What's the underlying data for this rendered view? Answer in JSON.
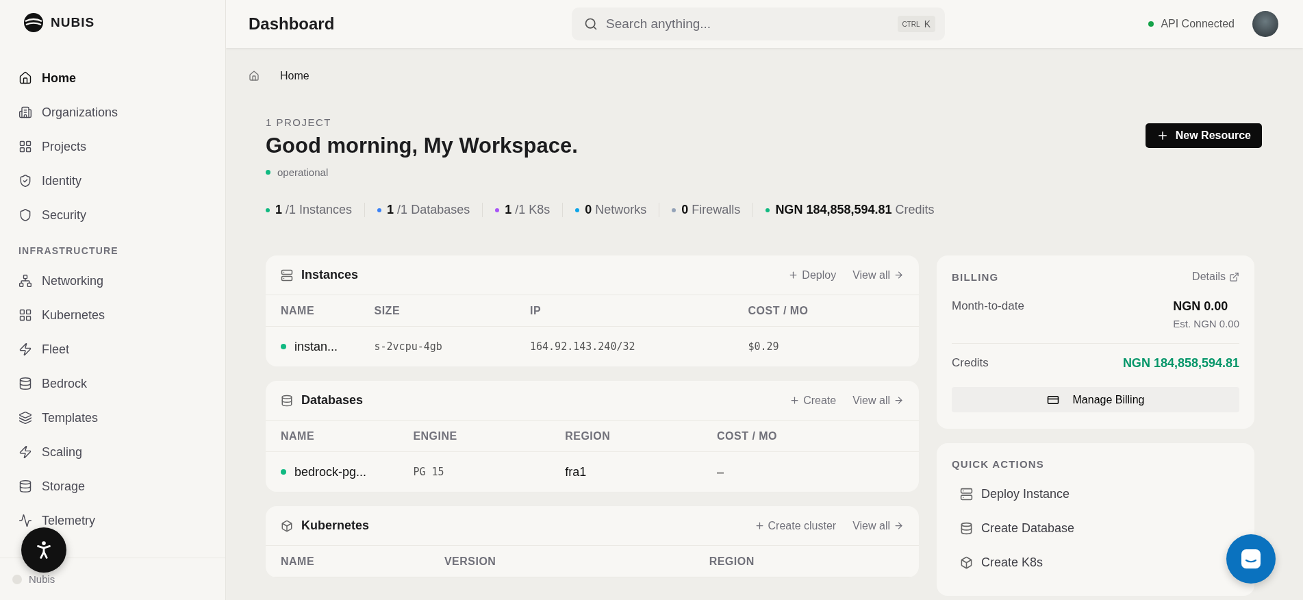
{
  "brand": {
    "name": "NUBIS"
  },
  "sidebar": {
    "items": [
      {
        "label": "Home",
        "selected": true
      },
      {
        "label": "Organizations",
        "selected": false
      },
      {
        "label": "Projects",
        "selected": false
      },
      {
        "label": "Identity",
        "selected": false
      },
      {
        "label": "Security",
        "selected": false
      }
    ],
    "section": "INFRASTRUCTURE",
    "infra_items": [
      {
        "label": "Networking",
        "selected": false
      },
      {
        "label": "Kubernetes",
        "selected": false
      },
      {
        "label": "Fleet",
        "selected": false
      },
      {
        "label": "Bedrock",
        "selected": false
      },
      {
        "label": "Templates",
        "selected": false
      },
      {
        "label": "Scaling",
        "selected": false
      },
      {
        "label": "Storage",
        "selected": false
      },
      {
        "label": "Telemetry",
        "selected": false
      }
    ],
    "footer": "Nubis"
  },
  "header": {
    "title": "Dashboard",
    "search": {
      "placeholder": "Search anything...",
      "shortcut_mod": "CTRL",
      "shortcut_key": "K"
    },
    "status": {
      "label": "API Connected",
      "color": "#16a34a"
    }
  },
  "breadcrumb": [
    "Home"
  ],
  "hero": {
    "eyebrow": "1 PROJECT",
    "title": "Good morning, My Workspace.",
    "status": {
      "label": "operational",
      "color": "#10b981"
    },
    "action": "New Resource"
  },
  "stats": [
    {
      "value": "1",
      "total": "/1",
      "label": "Instances",
      "color": "#10b981"
    },
    {
      "value": "1",
      "total": "/1",
      "label": "Databases",
      "color": "#3b82f6"
    },
    {
      "value": "1",
      "total": "/1",
      "label": "K8s",
      "color": "#a855f7"
    },
    {
      "value": "0",
      "label": "Networks",
      "color": "#0ea5e9"
    },
    {
      "value": "0",
      "label": "Firewalls",
      "color": "#94a3b8"
    },
    {
      "value": "NGN 184,858,594.81",
      "label": "Credits",
      "color": "#10b981"
    }
  ],
  "panels": [
    {
      "title": "Instances",
      "action": "Deploy",
      "view_all": "View all",
      "columns": [
        "NAME",
        "SIZE",
        "IP",
        "COST / MO"
      ],
      "rows": [
        {
          "color": "#10b981",
          "cells": [
            "instan...",
            "s-2vcpu-4gb",
            "164.92.143.240/32",
            "$0.29"
          ]
        }
      ]
    },
    {
      "title": "Databases",
      "action": "Create",
      "view_all": "View all",
      "columns": [
        "NAME",
        "ENGINE",
        "REGION",
        "COST / MO"
      ],
      "rows": [
        {
          "color": "#10b981",
          "cells": [
            "bedrock-pg...",
            "PG 15",
            "fra1",
            "–"
          ]
        }
      ]
    },
    {
      "title": "Kubernetes",
      "action": "Create cluster",
      "view_all": "View all",
      "columns": [
        "NAME",
        "VERSION",
        "REGION"
      ]
    }
  ],
  "billing": {
    "title": "BILLING",
    "details": "Details",
    "mtd_label": "Month-to-date",
    "mtd_value": "NGN 0.00",
    "estimate": "Est. NGN 0.00",
    "credits_label": "Credits",
    "credits_value": "NGN 184,858,594.81",
    "button": "Manage Billing"
  },
  "quick_actions": {
    "title": "QUICK ACTIONS",
    "items": [
      "Deploy Instance",
      "Create Database",
      "Create K8s"
    ]
  }
}
